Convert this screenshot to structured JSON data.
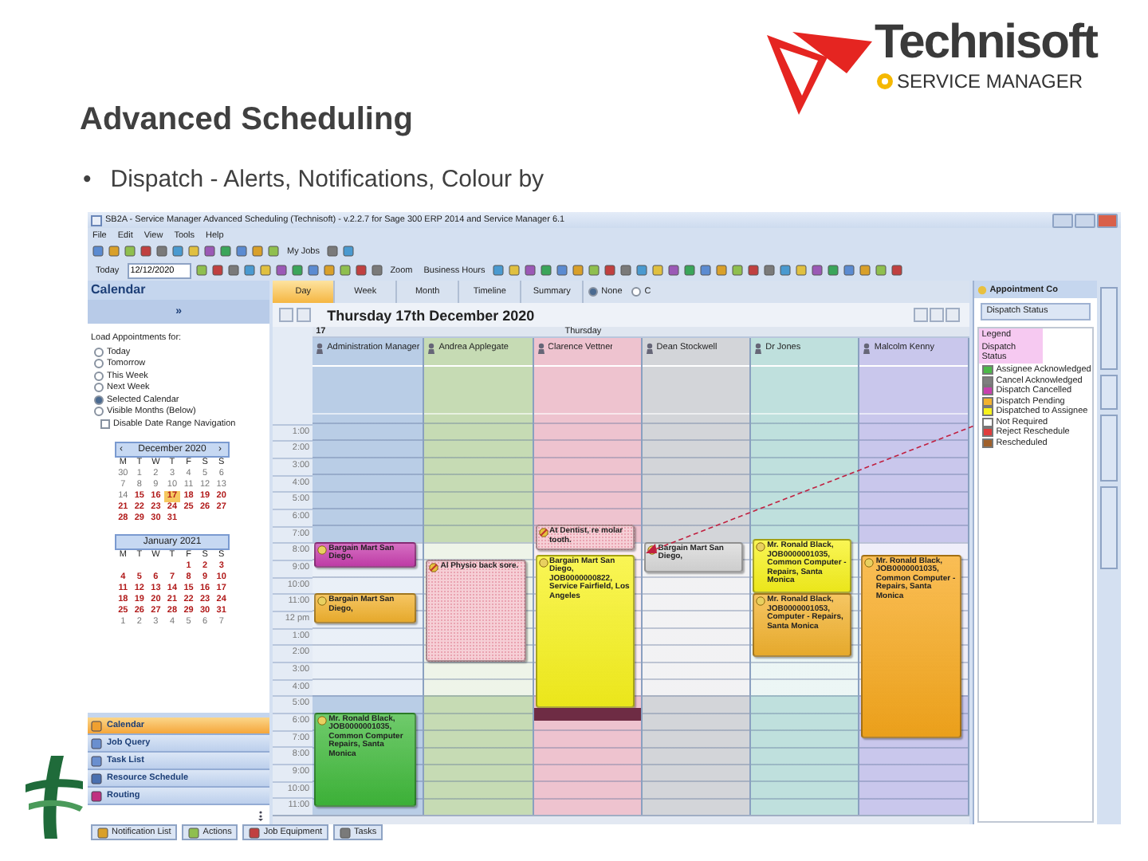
{
  "slide": {
    "title": "Advanced Scheduling",
    "bullet_mark": "•",
    "bullet": "Dispatch - Alerts, Notifications, Colour by",
    "logo": {
      "name": "Technisoft",
      "product": "SERVICE MANAGER"
    }
  },
  "window": {
    "title": "SB2A - Service Manager Advanced Scheduling (Technisoft) - v.2.2.7  for Sage 300 ERP 2014 and Service Manager 6.1",
    "menu": [
      "File",
      "Edit",
      "View",
      "Tools",
      "Help"
    ],
    "toolbar": {
      "my_jobs": "My Jobs",
      "today": "Today",
      "date": "12/12/2020",
      "zoom": "Zoom",
      "business_hours": "Business Hours"
    }
  },
  "calendar_pane": {
    "title": "Calendar",
    "expand": "»",
    "load_label": "Load Appointments for:",
    "options": [
      {
        "label": "Today",
        "selected": false
      },
      {
        "label": "Tomorrow",
        "selected": false
      },
      {
        "label": "This Week",
        "selected": false
      },
      {
        "label": "Next Week",
        "selected": false
      },
      {
        "label": "Selected Calendar",
        "selected": true
      },
      {
        "label": "Visible Months (Below)",
        "selected": false
      }
    ],
    "disable_nav": {
      "label": "Disable Date Range Navigation",
      "checked": false
    },
    "months": [
      {
        "title": "December 2020",
        "prev": "‹",
        "next": "›",
        "weekdays": [
          "M",
          "T",
          "W",
          "T",
          "F",
          "S",
          "S"
        ],
        "weeks": [
          [
            {
              "day": "30",
              "muted": true,
              "selected": false
            },
            {
              "day": "1",
              "muted": true,
              "selected": false
            },
            {
              "day": "2",
              "muted": true,
              "selected": false
            },
            {
              "day": "3",
              "muted": true,
              "selected": false
            },
            {
              "day": "4",
              "muted": true,
              "selected": false
            },
            {
              "day": "5",
              "muted": true,
              "selected": false
            },
            {
              "day": "6",
              "muted": true,
              "selected": false
            }
          ],
          [
            {
              "day": "7",
              "muted": true,
              "selected": false
            },
            {
              "day": "8",
              "muted": true,
              "selected": false
            },
            {
              "day": "9",
              "muted": true,
              "selected": false
            },
            {
              "day": "10",
              "muted": true,
              "selected": false
            },
            {
              "day": "11",
              "muted": true,
              "selected": false
            },
            {
              "day": "12",
              "muted": true,
              "selected": false
            },
            {
              "day": "13",
              "muted": true,
              "selected": false
            }
          ],
          [
            {
              "day": "14",
              "muted": true,
              "selected": false
            },
            {
              "day": "15",
              "muted": false,
              "selected": false
            },
            {
              "day": "16",
              "muted": false,
              "selected": false
            },
            {
              "day": "17",
              "muted": false,
              "selected": true
            },
            {
              "day": "18",
              "muted": false,
              "selected": false
            },
            {
              "day": "19",
              "muted": false,
              "selected": false
            },
            {
              "day": "20",
              "muted": false,
              "selected": false
            }
          ],
          [
            {
              "day": "21",
              "muted": false,
              "selected": false
            },
            {
              "day": "22",
              "muted": false,
              "selected": false
            },
            {
              "day": "23",
              "muted": false,
              "selected": false
            },
            {
              "day": "24",
              "muted": false,
              "selected": false
            },
            {
              "day": "25",
              "muted": false,
              "selected": false
            },
            {
              "day": "26",
              "muted": false,
              "selected": false
            },
            {
              "day": "27",
              "muted": false,
              "selected": false
            }
          ],
          [
            {
              "day": "28",
              "muted": false,
              "selected": false
            },
            {
              "day": "29",
              "muted": false,
              "selected": false
            },
            {
              "day": "30",
              "muted": false,
              "selected": false
            },
            {
              "day": "31",
              "muted": false,
              "selected": false
            }
          ]
        ]
      },
      {
        "title": "January 2021",
        "weekdays": [
          "M",
          "T",
          "W",
          "T",
          "F",
          "S",
          "S"
        ],
        "weeks": [
          [
            {
              "day": "1",
              "muted": false,
              "selected": false
            },
            {
              "day": "2",
              "muted": false,
              "selected": false
            },
            {
              "day": "3",
              "muted": false,
              "selected": false
            }
          ],
          [
            {
              "day": "4",
              "muted": false,
              "selected": false
            },
            {
              "day": "5",
              "muted": false,
              "selected": false
            },
            {
              "day": "6",
              "muted": false,
              "selected": false
            },
            {
              "day": "7",
              "muted": false,
              "selected": false
            },
            {
              "day": "8",
              "muted": false,
              "selected": false
            },
            {
              "day": "9",
              "muted": false,
              "selected": false
            },
            {
              "day": "10",
              "muted": false,
              "selected": false
            }
          ],
          [
            {
              "day": "11",
              "muted": false,
              "selected": false
            },
            {
              "day": "12",
              "muted": false,
              "selected": false
            },
            {
              "day": "13",
              "muted": false,
              "selected": false
            },
            {
              "day": "14",
              "muted": false,
              "selected": false
            },
            {
              "day": "15",
              "muted": false,
              "selected": false
            },
            {
              "day": "16",
              "muted": false,
              "selected": false
            },
            {
              "day": "17",
              "muted": false,
              "selected": false
            }
          ],
          [
            {
              "day": "18",
              "muted": false,
              "selected": false
            },
            {
              "day": "19",
              "muted": false,
              "selected": false
            },
            {
              "day": "20",
              "muted": false,
              "selected": false
            },
            {
              "day": "21",
              "muted": false,
              "selected": false
            },
            {
              "day": "22",
              "muted": false,
              "selected": false
            },
            {
              "day": "23",
              "muted": false,
              "selected": false
            },
            {
              "day": "24",
              "muted": false,
              "selected": false
            }
          ],
          [
            {
              "day": "25",
              "muted": false,
              "selected": false
            },
            {
              "day": "26",
              "muted": false,
              "selected": false
            },
            {
              "day": "27",
              "muted": false,
              "selected": false
            },
            {
              "day": "28",
              "muted": false,
              "selected": false
            },
            {
              "day": "29",
              "muted": false,
              "selected": false
            },
            {
              "day": "30",
              "muted": false,
              "selected": false
            },
            {
              "day": "31",
              "muted": false,
              "selected": false
            }
          ],
          [
            {
              "day": "1",
              "muted": true,
              "selected": false
            },
            {
              "day": "2",
              "muted": true,
              "selected": false
            },
            {
              "day": "3",
              "muted": true,
              "selected": false
            },
            {
              "day": "4",
              "muted": true,
              "selected": false
            },
            {
              "day": "5",
              "muted": true,
              "selected": false
            },
            {
              "day": "6",
              "muted": true,
              "selected": false
            },
            {
              "day": "7",
              "muted": true,
              "selected": false
            }
          ]
        ]
      }
    ],
    "nav": [
      {
        "label": "Calendar",
        "selected": true
      },
      {
        "label": "Job Query",
        "selected": false
      },
      {
        "label": "Task List",
        "selected": false
      },
      {
        "label": "Resource Schedule",
        "selected": false
      },
      {
        "label": "Routing",
        "selected": false
      }
    ]
  },
  "scheduler": {
    "views": [
      {
        "label": "Day",
        "selected": true
      },
      {
        "label": "Week",
        "selected": false
      },
      {
        "label": "Month",
        "selected": false
      },
      {
        "label": "Timeline",
        "selected": false
      },
      {
        "label": "Summary",
        "selected": false
      }
    ],
    "grouping": [
      {
        "label": "None",
        "selected": true
      },
      {
        "label": "C",
        "selected": false
      }
    ],
    "date_title": "Thursday 17th December 2020",
    "day_number": "17",
    "day_name": "Thursday",
    "times": [
      {
        "label": "1:00",
        "business": false
      },
      {
        "label": "2:00",
        "business": false
      },
      {
        "label": "3:00",
        "business": false
      },
      {
        "label": "4:00",
        "business": false
      },
      {
        "label": "5:00",
        "business": false
      },
      {
        "label": "6:00",
        "business": false
      },
      {
        "label": "7:00",
        "business": false
      },
      {
        "label": "8:00",
        "business": true
      },
      {
        "label": "9:00",
        "business": true
      },
      {
        "label": "10:00",
        "business": true
      },
      {
        "label": "11:00",
        "business": true
      },
      {
        "label": "12 pm",
        "business": true
      },
      {
        "label": "1:00",
        "business": true
      },
      {
        "label": "2:00",
        "business": true
      },
      {
        "label": "3:00",
        "business": true
      },
      {
        "label": "4:00",
        "business": true
      },
      {
        "label": "5:00",
        "business": false
      },
      {
        "label": "6:00",
        "business": false
      },
      {
        "label": "7:00",
        "business": false
      },
      {
        "label": "8:00",
        "business": false
      },
      {
        "label": "9:00",
        "business": false
      },
      {
        "label": "10:00",
        "business": false
      },
      {
        "label": "11:00",
        "business": false
      }
    ],
    "resources": [
      {
        "name": "Administration Manager",
        "color": "#b9cde6",
        "appointments": [
          {
            "kind": "appointment",
            "text": "Bargain Mart San Diego,",
            "color": "#c83fae"
          },
          {
            "kind": "appointment",
            "text": "Bargain Mart San Diego,",
            "color": "#f2b22e"
          },
          {
            "kind": "appointment",
            "text": "Mr. Ronald Black, JOB0000001035, Common Computer Repairs, Santa Monica",
            "color": "#3fb93a"
          }
        ]
      },
      {
        "name": "Andrea Applegate",
        "color": "#c6dbb4",
        "appointments": [
          {
            "kind": "personal",
            "text": "Al Physio back sore.",
            "color": "#f6cfd6"
          }
        ]
      },
      {
        "name": "Clarence Vettner",
        "color": "#eec3cf",
        "appointments": [
          {
            "kind": "personal",
            "text": "At Dentist, re molar tooth.",
            "color": "#f6cfd6"
          },
          {
            "kind": "appointment",
            "text": "Bargain Mart San Diego, JOB0000000822, Service Fairfield, Los Angeles",
            "color": "#f7f21c"
          },
          {
            "kind": "block",
            "color": "#6e2c44"
          }
        ]
      },
      {
        "name": "Dean Stockwell",
        "color": "#d3d5d9",
        "appointments": [
          {
            "kind": "appointment",
            "text": "Bargain Mart San Diego,",
            "color": "#d8d8d8"
          }
        ]
      },
      {
        "name": "Dr Jones",
        "color": "#bfe0dd",
        "appointments": [
          {
            "kind": "appointment",
            "text": "Mr. Ronald Black, JOB0000001035, Common Computer - Repairs, Santa Monica",
            "color": "#f7f21c"
          },
          {
            "kind": "appointment",
            "text": "Mr. Ronald Black, JOB0000001053, Computer - Repairs, Santa Monica",
            "color": "#f2b22e"
          }
        ]
      },
      {
        "name": "Malcolm Kenny",
        "color": "#c9c7ec",
        "appointments": [
          {
            "kind": "appointment",
            "text": "Mr. Ronald Black, JOB0000001035, Common Computer - Repairs, Santa Monica",
            "color": "#f7a81c"
          }
        ]
      }
    ]
  },
  "appointment_panel": {
    "title": "Appointment Co",
    "filter": "Dispatch Status",
    "legend_label": "Legend",
    "legend_title": "Dispatch Status",
    "legend": [
      {
        "label": "Assignee Acknowledged",
        "color": "#4cb848"
      },
      {
        "label": "Cancel Acknowledged",
        "color": "#7f7f7f"
      },
      {
        "label": "Dispatch Cancelled",
        "color": "#c83fae"
      },
      {
        "label": "Dispatch Pending",
        "color": "#f2b22e"
      },
      {
        "label": "Dispatched to Assignee",
        "color": "#f7f21c"
      },
      {
        "label": "Not Required",
        "color": "#ffffff"
      },
      {
        "label": "Reject Reschedule",
        "color": "#e03c3c"
      },
      {
        "label": "Rescheduled",
        "color": "#a0602a"
      }
    ]
  },
  "bottom_tabs": [
    "Notification List",
    "Actions",
    "Job Equipment",
    "Tasks"
  ]
}
